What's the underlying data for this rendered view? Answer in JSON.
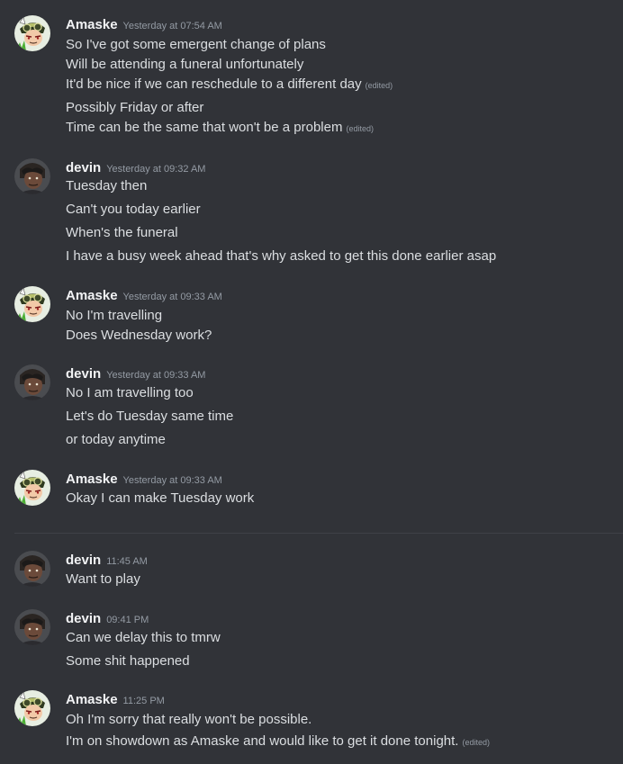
{
  "users": {
    "amaske": {
      "name": "Amaske",
      "avatar_icon": "goggles-character-icon",
      "avatar_bg": "#e7eee2"
    },
    "devin": {
      "name": "devin",
      "avatar_icon": "dark-character-icon",
      "avatar_bg": "#3a3c40"
    }
  },
  "colors": {
    "background": "#313338",
    "text": "#dbdee1",
    "muted": "#949ba4",
    "username": "#f2f3f5"
  },
  "groups": [
    {
      "user": "Amaske",
      "time": "Yesterday at 07:54 AM",
      "messages": [
        {
          "text": "So I've got some emergent change of plans"
        },
        {
          "text": "Will be attending a funeral unfortunately"
        },
        {
          "text": "It'd be nice if we can reschedule to a different day",
          "edited": "(edited)"
        },
        {
          "text": "Possibly Friday or after"
        },
        {
          "text": "Time can be the same that won't be a problem",
          "edited": "(edited)"
        }
      ]
    },
    {
      "user": "devin",
      "time": "Yesterday at 09:32 AM",
      "messages": [
        {
          "text": "Tuesday then"
        },
        {
          "text": "Can't you today earlier"
        },
        {
          "text": "When's the funeral"
        },
        {
          "text": "I have a busy week ahead that's why asked to get this done earlier asap"
        }
      ]
    },
    {
      "user": "Amaske",
      "time": "Yesterday at 09:33 AM",
      "messages": [
        {
          "text": "No I'm travelling"
        },
        {
          "text": "Does Wednesday work?"
        }
      ]
    },
    {
      "user": "devin",
      "time": "Yesterday at 09:33 AM",
      "messages": [
        {
          "text": "No I am travelling too"
        },
        {
          "text": "Let's do Tuesday same time"
        },
        {
          "text": "or today anytime"
        }
      ]
    },
    {
      "user": "Amaske",
      "time": "Yesterday at 09:33 AM",
      "messages": [
        {
          "text": "Okay I can make Tuesday work"
        }
      ]
    },
    {
      "user": "devin",
      "time": "11:45 AM",
      "messages": [
        {
          "text": "Want to play"
        }
      ]
    },
    {
      "user": "devin",
      "time": "09:41 PM",
      "messages": [
        {
          "text": "Can we delay this to tmrw"
        },
        {
          "text": "Some shit happened"
        }
      ]
    },
    {
      "user": "Amaske",
      "time": "11:25 PM",
      "messages": [
        {
          "text": "Oh I'm sorry that really won't be possible."
        },
        {
          "text": "I'm on showdown as Amaske and would like to get it done tonight.",
          "edited": "(edited)"
        }
      ]
    }
  ]
}
